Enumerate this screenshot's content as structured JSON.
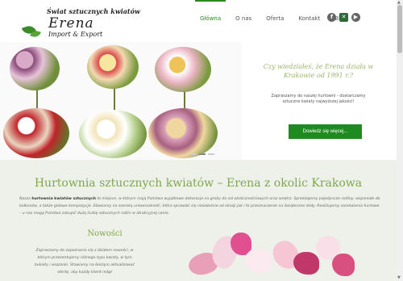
{
  "header": {
    "logo": {
      "tagline": "Świat sztucznych kwiatów",
      "name": "Erena",
      "sub": "Import & Export"
    },
    "nav": [
      {
        "label": "Główna",
        "active": true
      },
      {
        "label": "O nas",
        "active": false
      },
      {
        "label": "Oferta",
        "active": false
      },
      {
        "label": "Kontakt",
        "active": false
      },
      {
        "label": "Blog",
        "active": false
      }
    ],
    "icons": [
      "facebook-icon",
      "tools-icon",
      "youtube-icon"
    ]
  },
  "hero": {
    "question": "Czy wiedziałeś, że Erena działa w Krakowie od 1991 r.?",
    "text": "Zapraszamy do naszej hurtowni - dostarczamy sztuczne kwiaty najwyższej jakości!",
    "button": "Dowiedz się więcej...",
    "slides": 3,
    "active_slide": 2
  },
  "main": {
    "title": "Hurtownia sztucznych kwiatów – Erena z okolic Krakowa",
    "intro_prefix": "Nasza ",
    "intro_bold": "hurtownia kwiatów sztucznych",
    "intro_rest": " to miejsce, w którym mają Państwo wyjątkowe dekoracje na groby do sal okolicznościowych oraz wnętrz. Sprzedajemy pojedyncze rośliny, wspaniałe do balkonów, a także gotowe kompozycje. Stawiamy na szeroką uniwersalność, która sprawdzi się niezależnie od okazji jak i to przeznaczenie na świąteczne stoły. Realizujemy zamówienia hurtowe – u nas mogą Państwo zakupić dużą liczbę sztucznych roślin w atrakcyjnej cenie.",
    "news_title": "Nowości",
    "news_text": "Zapraszamy do zapoznania się z działem nowości, w którym przezentujemy różnego typu kwiaty, w tym bukiety i wiązanki. Stawiamy na bieżąco aktualizować ofertę, aby każdy klient mógł"
  },
  "colors": {
    "brand_green": "#1f8a1f",
    "heading_green": "#7fa84a",
    "content_bg": "#eef1ea"
  }
}
